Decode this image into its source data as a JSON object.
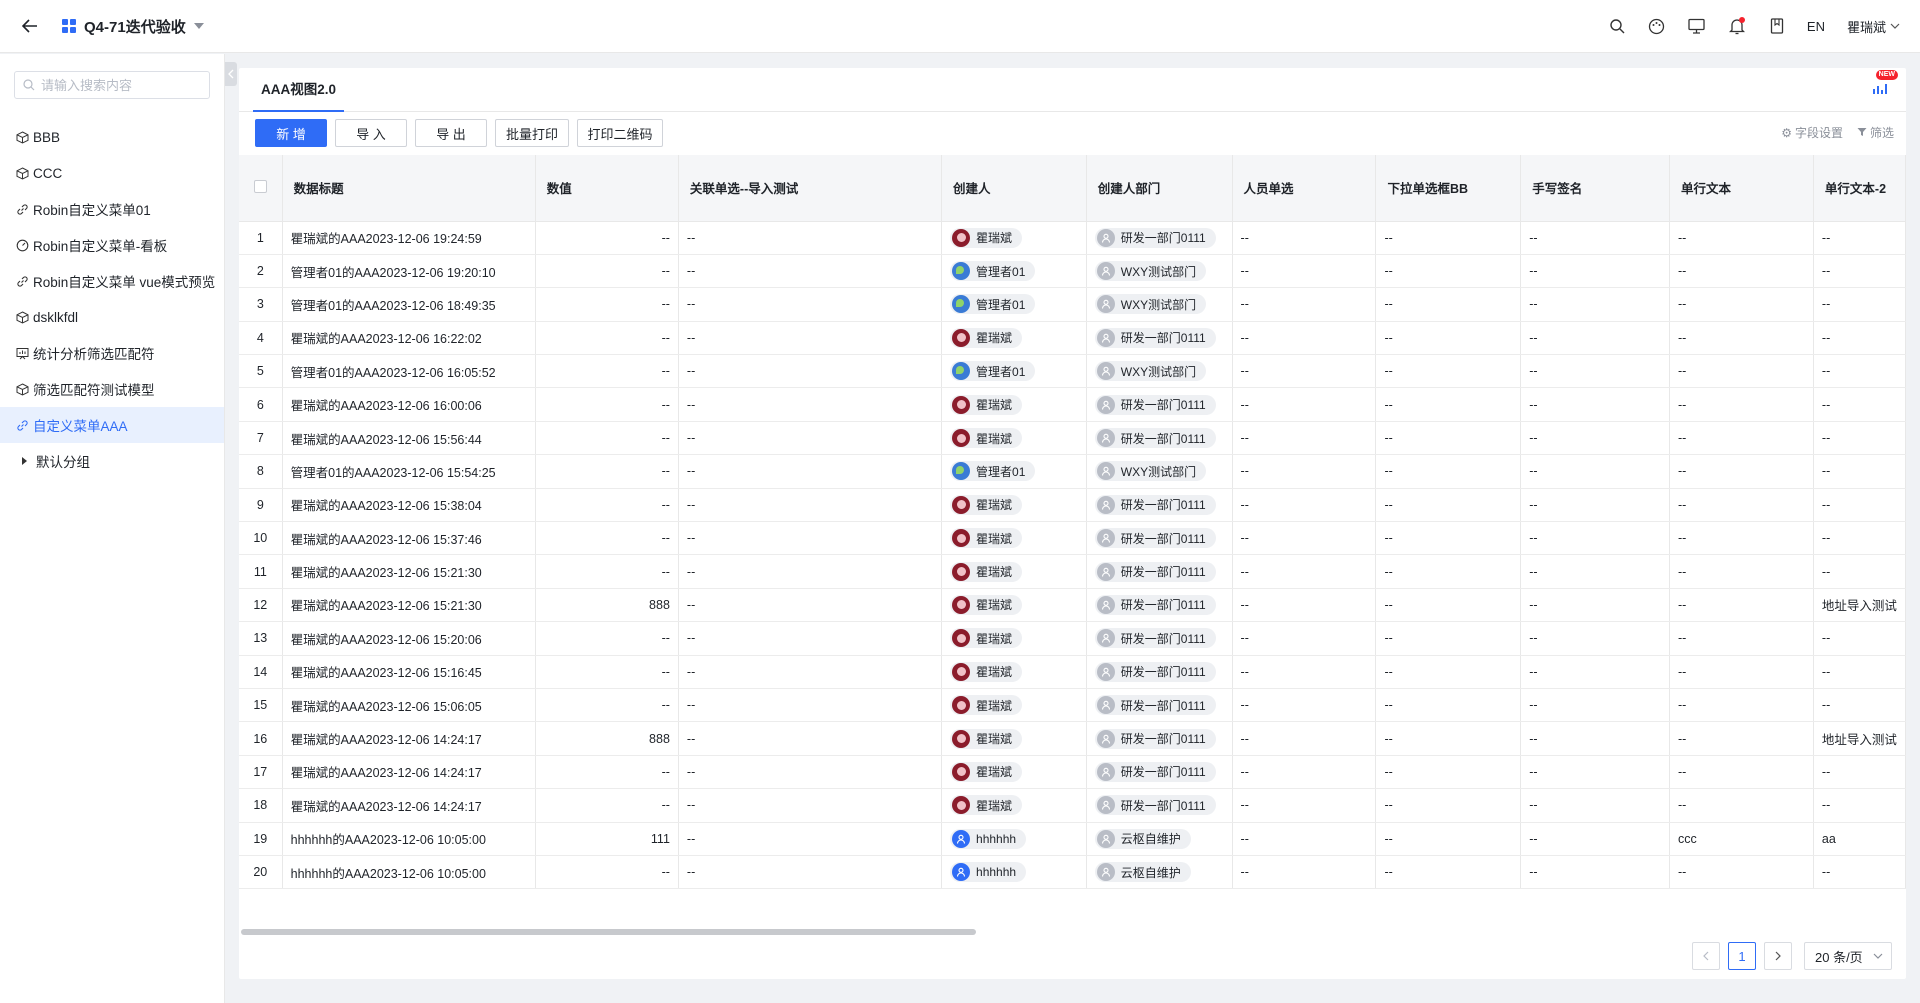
{
  "header": {
    "app_title": "Q4-71迭代验收",
    "lang": "EN",
    "user": "瞿瑞斌"
  },
  "sidebar": {
    "search_placeholder": "请输入搜索内容",
    "items": [
      {
        "label": "BBB",
        "icon": "cube-icon"
      },
      {
        "label": "CCC",
        "icon": "cube-icon"
      },
      {
        "label": "Robin自定义菜单01",
        "icon": "link-icon"
      },
      {
        "label": "Robin自定义菜单-看板",
        "icon": "dashboard-icon"
      },
      {
        "label": "Robin自定义菜单 vue模式预览",
        "icon": "link-icon"
      },
      {
        "label": "dsklkfdl",
        "icon": "cube-icon"
      },
      {
        "label": "统计分析筛选匹配符",
        "icon": "chart-icon"
      },
      {
        "label": "筛选匹配符测试模型",
        "icon": "cube-icon"
      },
      {
        "label": "自定义菜单AAA",
        "icon": "link-icon",
        "active": true
      }
    ],
    "sub_item": "默认分组"
  },
  "panel": {
    "tab": "AAA视图2.0",
    "new_badge": "NEW"
  },
  "toolbar": {
    "add": "新 增",
    "import": "导 入",
    "export": "导 出",
    "batch_print": "批量打印",
    "print_qr": "打印二维码",
    "field_settings": "字段设置",
    "filter": "筛选"
  },
  "table": {
    "columns": [
      "数据标题",
      "数值",
      "关联单选--导入测试",
      "创建人",
      "创建人部门",
      "人员单选",
      "下拉单选框BB",
      "手写签名",
      "单行文本",
      "单行文本-2"
    ],
    "rows": [
      {
        "idx": "1",
        "title": "瞿瑞斌的AAA2023-12-06 19:24:59",
        "value": "--",
        "rel": "--",
        "creator": "瞿瑞斌",
        "avatar": "red",
        "dept": "研发一部门0111",
        "person": "--",
        "dropdown": "--",
        "sign": "--",
        "text": "--",
        "text2": "--"
      },
      {
        "idx": "2",
        "title": "管理者01的AAA2023-12-06 19:20:10",
        "value": "--",
        "rel": "--",
        "creator": "管理者01",
        "avatar": "globe",
        "dept": "WXY测试部门",
        "person": "--",
        "dropdown": "--",
        "sign": "--",
        "text": "--",
        "text2": "--"
      },
      {
        "idx": "3",
        "title": "管理者01的AAA2023-12-06 18:49:35",
        "value": "--",
        "rel": "--",
        "creator": "管理者01",
        "avatar": "globe",
        "dept": "WXY测试部门",
        "person": "--",
        "dropdown": "--",
        "sign": "--",
        "text": "--",
        "text2": "--"
      },
      {
        "idx": "4",
        "title": "瞿瑞斌的AAA2023-12-06 16:22:02",
        "value": "--",
        "rel": "--",
        "creator": "瞿瑞斌",
        "avatar": "red",
        "dept": "研发一部门0111",
        "person": "--",
        "dropdown": "--",
        "sign": "--",
        "text": "--",
        "text2": "--"
      },
      {
        "idx": "5",
        "title": "管理者01的AAA2023-12-06 16:05:52",
        "value": "--",
        "rel": "--",
        "creator": "管理者01",
        "avatar": "globe",
        "dept": "WXY测试部门",
        "person": "--",
        "dropdown": "--",
        "sign": "--",
        "text": "--",
        "text2": "--"
      },
      {
        "idx": "6",
        "title": "瞿瑞斌的AAA2023-12-06 16:00:06",
        "value": "--",
        "rel": "--",
        "creator": "瞿瑞斌",
        "avatar": "red",
        "dept": "研发一部门0111",
        "person": "--",
        "dropdown": "--",
        "sign": "--",
        "text": "--",
        "text2": "--"
      },
      {
        "idx": "7",
        "title": "瞿瑞斌的AAA2023-12-06 15:56:44",
        "value": "--",
        "rel": "--",
        "creator": "瞿瑞斌",
        "avatar": "red",
        "dept": "研发一部门0111",
        "person": "--",
        "dropdown": "--",
        "sign": "--",
        "text": "--",
        "text2": "--"
      },
      {
        "idx": "8",
        "title": "管理者01的AAA2023-12-06 15:54:25",
        "value": "--",
        "rel": "--",
        "creator": "管理者01",
        "avatar": "globe",
        "dept": "WXY测试部门",
        "person": "--",
        "dropdown": "--",
        "sign": "--",
        "text": "--",
        "text2": "--"
      },
      {
        "idx": "9",
        "title": "瞿瑞斌的AAA2023-12-06 15:38:04",
        "value": "--",
        "rel": "--",
        "creator": "瞿瑞斌",
        "avatar": "red",
        "dept": "研发一部门0111",
        "person": "--",
        "dropdown": "--",
        "sign": "--",
        "text": "--",
        "text2": "--"
      },
      {
        "idx": "10",
        "title": "瞿瑞斌的AAA2023-12-06 15:37:46",
        "value": "--",
        "rel": "--",
        "creator": "瞿瑞斌",
        "avatar": "red",
        "dept": "研发一部门0111",
        "person": "--",
        "dropdown": "--",
        "sign": "--",
        "text": "--",
        "text2": "--"
      },
      {
        "idx": "11",
        "title": "瞿瑞斌的AAA2023-12-06 15:21:30",
        "value": "--",
        "rel": "--",
        "creator": "瞿瑞斌",
        "avatar": "red",
        "dept": "研发一部门0111",
        "person": "--",
        "dropdown": "--",
        "sign": "--",
        "text": "--",
        "text2": "--"
      },
      {
        "idx": "12",
        "title": "瞿瑞斌的AAA2023-12-06 15:21:30",
        "value": "888",
        "rel": "--",
        "creator": "瞿瑞斌",
        "avatar": "red",
        "dept": "研发一部门0111",
        "person": "--",
        "dropdown": "--",
        "sign": "--",
        "text": "--",
        "text2": "地址导入测试"
      },
      {
        "idx": "13",
        "title": "瞿瑞斌的AAA2023-12-06 15:20:06",
        "value": "--",
        "rel": "--",
        "creator": "瞿瑞斌",
        "avatar": "red",
        "dept": "研发一部门0111",
        "person": "--",
        "dropdown": "--",
        "sign": "--",
        "text": "--",
        "text2": "--"
      },
      {
        "idx": "14",
        "title": "瞿瑞斌的AAA2023-12-06 15:16:45",
        "value": "--",
        "rel": "--",
        "creator": "瞿瑞斌",
        "avatar": "red",
        "dept": "研发一部门0111",
        "person": "--",
        "dropdown": "--",
        "sign": "--",
        "text": "--",
        "text2": "--"
      },
      {
        "idx": "15",
        "title": "瞿瑞斌的AAA2023-12-06 15:06:05",
        "value": "--",
        "rel": "--",
        "creator": "瞿瑞斌",
        "avatar": "red",
        "dept": "研发一部门0111",
        "person": "--",
        "dropdown": "--",
        "sign": "--",
        "text": "--",
        "text2": "--"
      },
      {
        "idx": "16",
        "title": "瞿瑞斌的AAA2023-12-06 14:24:17",
        "value": "888",
        "rel": "--",
        "creator": "瞿瑞斌",
        "avatar": "red",
        "dept": "研发一部门0111",
        "person": "--",
        "dropdown": "--",
        "sign": "--",
        "text": "--",
        "text2": "地址导入测试"
      },
      {
        "idx": "17",
        "title": "瞿瑞斌的AAA2023-12-06 14:24:17",
        "value": "--",
        "rel": "--",
        "creator": "瞿瑞斌",
        "avatar": "red",
        "dept": "研发一部门0111",
        "person": "--",
        "dropdown": "--",
        "sign": "--",
        "text": "--",
        "text2": "--"
      },
      {
        "idx": "18",
        "title": "瞿瑞斌的AAA2023-12-06 14:24:17",
        "value": "--",
        "rel": "--",
        "creator": "瞿瑞斌",
        "avatar": "red",
        "dept": "研发一部门0111",
        "person": "--",
        "dropdown": "--",
        "sign": "--",
        "text": "--",
        "text2": "--"
      },
      {
        "idx": "19",
        "title": "hhhhhh的AAA2023-12-06 10:05:00",
        "value": "111",
        "rel": "--",
        "creator": "hhhhhh",
        "avatar": "blue",
        "dept": "云枢自维护",
        "person": "--",
        "dropdown": "--",
        "sign": "--",
        "text": "ccc",
        "text2": "aa"
      },
      {
        "idx": "20",
        "title": "hhhhhh的AAA2023-12-06 10:05:00",
        "value": "--",
        "rel": "--",
        "creator": "hhhhhh",
        "avatar": "blue",
        "dept": "云枢自维护",
        "person": "--",
        "dropdown": "--",
        "sign": "--",
        "text": "--",
        "text2": "--"
      }
    ]
  },
  "pagination": {
    "current": "1",
    "page_size": "20 条/页"
  },
  "colors": {
    "primary": "#2f6cf6",
    "active_bg": "#e8f0fe",
    "header_bg": "#f5f6f8"
  }
}
